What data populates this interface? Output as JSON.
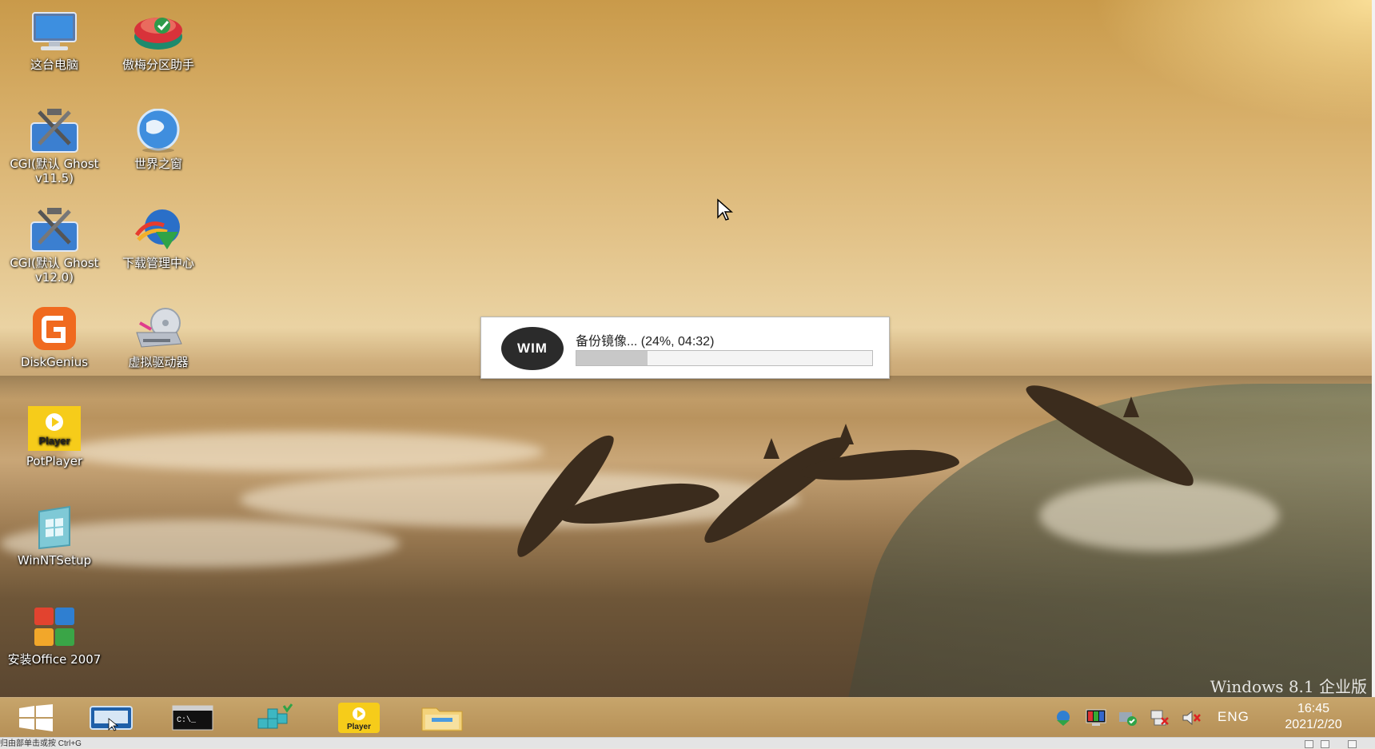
{
  "desktop": {
    "watermark": "Windows 8.1 企业版",
    "icons": [
      {
        "label": "这台电脑",
        "icon": "computer-icon"
      },
      {
        "label": "傲梅分区助手",
        "icon": "partition-assistant-icon"
      },
      {
        "label": "CGI(默认 Ghost v11.5)",
        "icon": "cgi-ghost-icon"
      },
      {
        "label": "世界之窗",
        "icon": "globe-browser-icon"
      },
      {
        "label": "CGI(默认 Ghost v12.0)",
        "icon": "cgi-ghost-icon"
      },
      {
        "label": "下载管理中心",
        "icon": "download-manager-icon"
      },
      {
        "label": "DiskGenius",
        "icon": "diskgenius-icon"
      },
      {
        "label": "虚拟驱动器",
        "icon": "virtual-drive-icon"
      },
      {
        "label": "PotPlayer",
        "icon": "potplayer-icon"
      },
      {
        "label": "WinNTSetup",
        "icon": "winntsetup-icon"
      },
      {
        "label": "安装Office 2007",
        "icon": "office-icon"
      }
    ]
  },
  "dialog": {
    "logo": "WIM",
    "status": "备份镜像... (24%, 04:32)",
    "progress_percent": 24
  },
  "taskbar": {
    "items": [
      "start-icon",
      "screen-keyboard-icon",
      "command-prompt-icon",
      "package-icon",
      "potplayer-icon",
      "file-explorer-icon"
    ],
    "potplayer_label": "Player",
    "cmd_label": "C:\\_",
    "tray_icons": [
      "network-globe-icon",
      "monitor-icon",
      "security-shield-icon",
      "network-disconnected-icon",
      "volume-muted-icon"
    ],
    "language": "ENG",
    "time": "16:45",
    "date": "2021/2/20"
  },
  "icons_text": {
    "potplayer": "Player"
  },
  "statusbar": {
    "text": "归由部单击或按 Ctrl+G"
  }
}
